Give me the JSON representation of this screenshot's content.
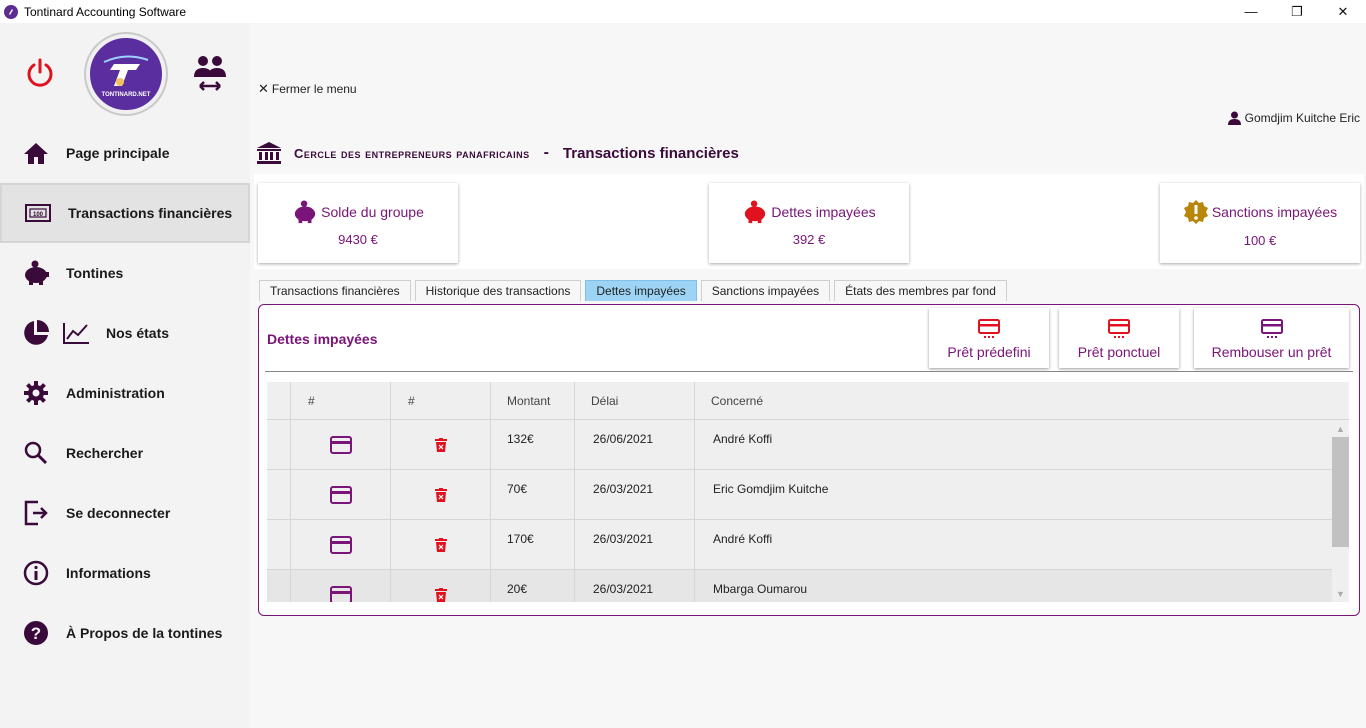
{
  "window": {
    "title": "Tontinard Accounting Software",
    "minimize": "—",
    "maximize": "❐",
    "close": "✕"
  },
  "sidebar": {
    "logo_text": "TONTINARD.NET",
    "items": [
      {
        "label": "Page principale",
        "icon": "home-icon"
      },
      {
        "label": "Transactions financières",
        "icon": "banknote-icon",
        "active": true
      },
      {
        "label": "Tontines",
        "icon": "piggy-bank-icon"
      },
      {
        "label": "Nos états",
        "icon": "pie-chart-icon"
      },
      {
        "label": "Administration",
        "icon": "gear-icon"
      },
      {
        "label": "Rechercher",
        "icon": "search-icon"
      },
      {
        "label": "Se deconnecter",
        "icon": "logout-icon"
      },
      {
        "label": "Informations",
        "icon": "info-icon"
      },
      {
        "label": "À Propos de la  tontines",
        "icon": "help-icon"
      }
    ]
  },
  "main": {
    "close_menu": "Fermer le menu",
    "user_name": "Gomdjim Kuitche Eric",
    "org_name": "Cercle des entrepreneurs panafricains",
    "separator": "-",
    "section_title": "Transactions financières",
    "cards": [
      {
        "title": "Solde du groupe",
        "value": "9430 €",
        "icon": "piggy-bank-icon",
        "color": "#7a1478"
      },
      {
        "title": "Dettes impayées",
        "value": "392 €",
        "icon": "piggy-bank-icon",
        "color": "#e0121f"
      },
      {
        "title": "Sanctions impayées",
        "value": "100 €",
        "icon": "warning-badge-icon",
        "color": "#b8860b"
      }
    ],
    "tabs": [
      {
        "label": "Transactions financières"
      },
      {
        "label": "Historique des transactions"
      },
      {
        "label": "Dettes impayées",
        "active": true
      },
      {
        "label": "Sanctions impayées"
      },
      {
        "label": "États des membres par fond"
      }
    ],
    "panel": {
      "title": "Dettes impayées",
      "buttons": [
        {
          "label": "Prêt prédefini",
          "icon": "credit-card-icon"
        },
        {
          "label": "Prêt ponctuel",
          "icon": "credit-card-icon"
        },
        {
          "label": "Rembouser un prêt",
          "icon": "credit-card-icon"
        }
      ]
    },
    "table": {
      "columns": [
        "#",
        "#",
        "Montant",
        "Délai",
        "Concerné"
      ],
      "rows": [
        {
          "montant": "132€",
          "delai": "26/06/2021",
          "concerne": "André Koffi"
        },
        {
          "montant": "70€",
          "delai": "26/03/2021",
          "concerne": "Eric Gomdjim Kuitche"
        },
        {
          "montant": "170€",
          "delai": "26/03/2021",
          "concerne": "André Koffi"
        },
        {
          "montant": "20€",
          "delai": "26/03/2021",
          "concerne": "Mbarga Oumarou"
        }
      ]
    }
  },
  "colors": {
    "accent": "#7a1478",
    "danger": "#e0121f",
    "tab_active": "#9dd4f5"
  }
}
